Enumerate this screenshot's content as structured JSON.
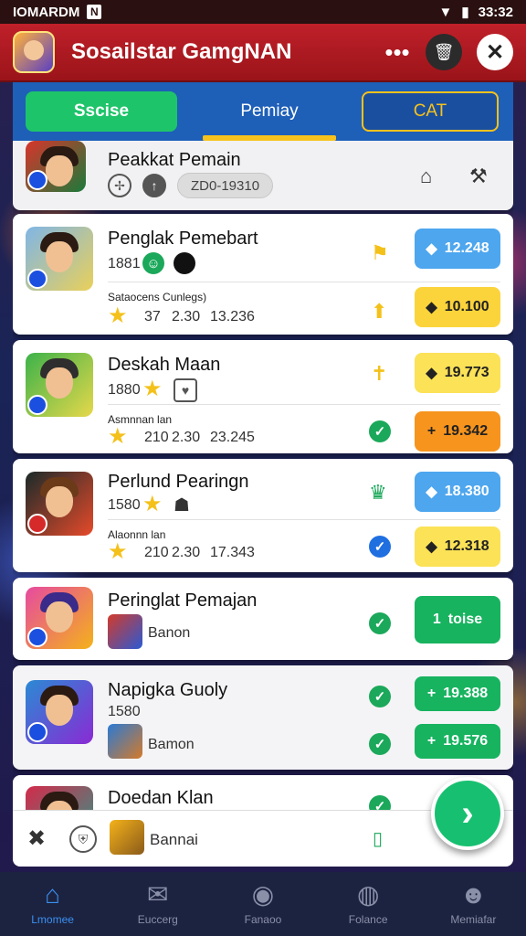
{
  "status_bar": {
    "left_text": "IOMARDM",
    "time": "33:32"
  },
  "header": {
    "title": "Sosailstar GamgNAN"
  },
  "tabs": [
    {
      "label": "Sscise"
    },
    {
      "label": "Pemiay"
    },
    {
      "label": "CAT"
    }
  ],
  "rows": [
    {
      "title": "Peakkat Pemain",
      "chip": "ZD0-19310"
    },
    {
      "title": "Penglak Pemebart",
      "level": "1881",
      "sub": "Sataocens Cunlegs)",
      "stats": [
        "37",
        "2.30",
        "13.236"
      ],
      "pill1": "12.248",
      "pill2": "10.100"
    },
    {
      "title": "Deskah Maan",
      "level": "1880",
      "sub": "Asmnnan lan",
      "stats": [
        "210",
        "2.30",
        "23.245"
      ],
      "pill1": "19.773",
      "pill2": "19.342"
    },
    {
      "title": "Perlund Pearingn",
      "level": "1580",
      "sub": "Alaonnn lan",
      "stats": [
        "210",
        "2.30",
        "17.343"
      ],
      "pill1": "18.380",
      "pill2": "12.318"
    },
    {
      "title": "Peringlat Pemajan",
      "sub2": "Banon",
      "pill1": "toise"
    },
    {
      "title": "Napigka Guoly",
      "level": "1580",
      "sub2": "Bamon",
      "pill1": "19.388",
      "pill2": "19.576"
    },
    {
      "title": "Doedan Klan"
    }
  ],
  "bottom_bar": {
    "label": "Bannai"
  },
  "nav": [
    {
      "label": "Lmomee"
    },
    {
      "label": "Euccerg"
    },
    {
      "label": "Fanaoo"
    },
    {
      "label": "Folance"
    },
    {
      "label": "Memiafar"
    }
  ],
  "colors": {
    "header_red": "#c0202a",
    "tab_blue": "#1e5fb8",
    "accent_green": "#17b35f",
    "accent_yellow": "#fbd43b"
  }
}
